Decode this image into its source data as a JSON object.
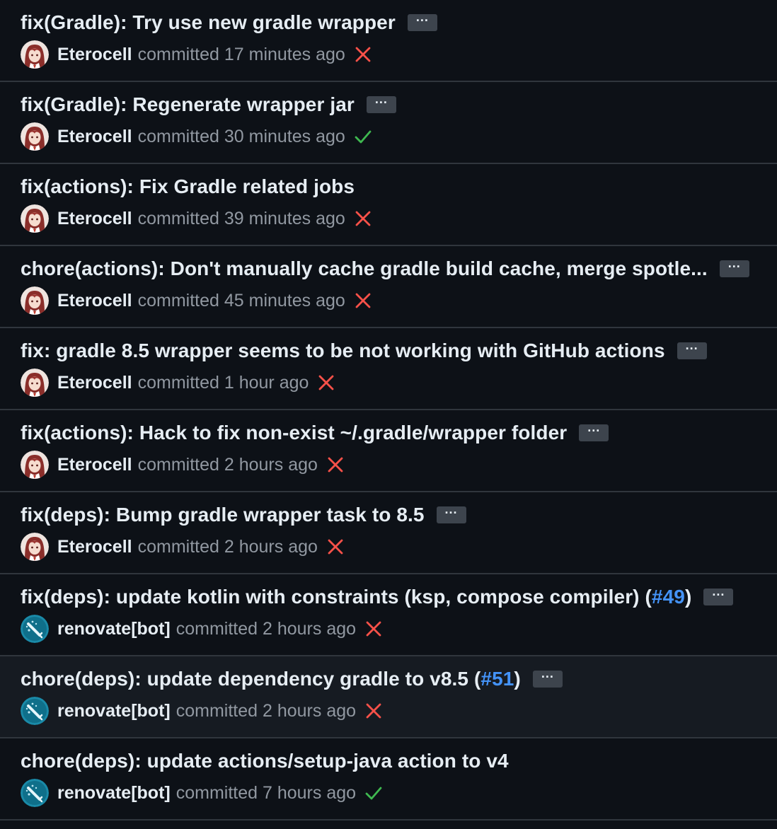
{
  "colors": {
    "background": "#0d1117",
    "hover_background": "#161b22",
    "border": "#30363d",
    "title": "#e6edf3",
    "muted": "#9198a1",
    "link": "#4493f8",
    "fail": "#f85149",
    "success": "#3fb950"
  },
  "commits": [
    {
      "title": "fix(Gradle): Try use new gradle wrapper",
      "pr": "",
      "has_more": true,
      "author": "Eterocell",
      "avatar_icon": "anime-avatar-icon",
      "time_text": "committed 17 minutes ago",
      "status": "failure",
      "status_icon": "x-icon"
    },
    {
      "title": "fix(Gradle): Regenerate wrapper jar",
      "pr": "",
      "has_more": true,
      "author": "Eterocell",
      "avatar_icon": "anime-avatar-icon",
      "time_text": "committed 30 minutes ago",
      "status": "success",
      "status_icon": "check-icon"
    },
    {
      "title": "fix(actions): Fix Gradle related jobs",
      "pr": "",
      "has_more": false,
      "author": "Eterocell",
      "avatar_icon": "anime-avatar-icon",
      "time_text": "committed 39 minutes ago",
      "status": "failure",
      "status_icon": "x-icon"
    },
    {
      "title": "chore(actions): Don't manually cache gradle build cache, merge spotle...",
      "pr": "",
      "has_more": true,
      "author": "Eterocell",
      "avatar_icon": "anime-avatar-icon",
      "time_text": "committed 45 minutes ago",
      "status": "failure",
      "status_icon": "x-icon"
    },
    {
      "title": "fix: gradle 8.5 wrapper seems to be not working with GitHub actions",
      "pr": "",
      "has_more": true,
      "author": "Eterocell",
      "avatar_icon": "anime-avatar-icon",
      "time_text": "committed 1 hour ago",
      "status": "failure",
      "status_icon": "x-icon"
    },
    {
      "title": "fix(actions): Hack to fix non-exist ~/.gradle/wrapper folder",
      "pr": "",
      "has_more": true,
      "author": "Eterocell",
      "avatar_icon": "anime-avatar-icon",
      "time_text": "committed 2 hours ago",
      "status": "failure",
      "status_icon": "x-icon"
    },
    {
      "title": "fix(deps): Bump gradle wrapper task to 8.5",
      "pr": "",
      "has_more": true,
      "author": "Eterocell",
      "avatar_icon": "anime-avatar-icon",
      "time_text": "committed 2 hours ago",
      "status": "failure",
      "status_icon": "x-icon"
    },
    {
      "title": "fix(deps): update kotlin with constraints (ksp, compose compiler) (",
      "pr": "#49",
      "title_suffix": ")",
      "has_more": true,
      "author": "renovate[bot]",
      "avatar_icon": "renovate-bot-icon",
      "time_text": "committed 2 hours ago",
      "status": "failure",
      "status_icon": "x-icon"
    },
    {
      "title": "chore(deps): update dependency gradle to v8.5 (",
      "pr": "#51",
      "title_suffix": ")",
      "has_more": true,
      "hovered": true,
      "author": "renovate[bot]",
      "avatar_icon": "renovate-bot-icon",
      "time_text": "committed 2 hours ago",
      "status": "failure",
      "status_icon": "x-icon"
    },
    {
      "title": "chore(deps): update actions/setup-java action to v4",
      "pr": "",
      "has_more": false,
      "author": "renovate[bot]",
      "avatar_icon": "renovate-bot-icon",
      "time_text": "committed 7 hours ago",
      "status": "success",
      "status_icon": "check-icon"
    }
  ],
  "more_button_label": "···"
}
